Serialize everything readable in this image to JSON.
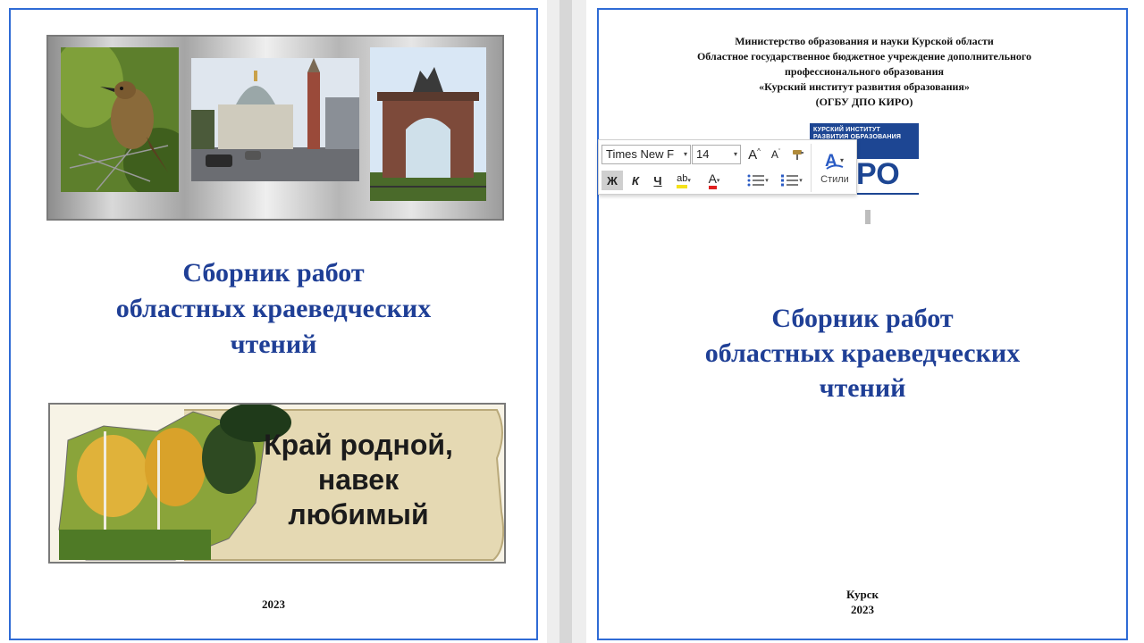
{
  "cover": {
    "title_lines": [
      "Сборник работ",
      "областных краеведческих",
      "чтений"
    ],
    "banner_lines": [
      "Край родной,",
      "навек",
      "любимый"
    ],
    "year": "2023"
  },
  "title_page": {
    "header_lines": [
      "Министерство образования и науки Курской области",
      "Областное государственное бюджетное учреждение дополнительного",
      "профессионального образования",
      "«Курский институт развития образования»",
      "(ОГБУ ДПО КИРО)"
    ],
    "logo_lines": [
      "КУРСКИЙ ИНСТИТУТ",
      "РАЗВИТИЯ ОБРАЗОВАНИЯ"
    ],
    "logo_letters": "РО",
    "title_lines": [
      "Сборник работ",
      "областных краеведческих",
      "чтений"
    ],
    "city": "Курск",
    "year": "2023"
  },
  "toolbar": {
    "font_name": "Times New F",
    "font_size": "14",
    "grow_font": "A",
    "shrink_font": "A",
    "bold": "Ж",
    "italic": "К",
    "underline": "Ч",
    "highlight": "ab",
    "font_color": "A",
    "styles_label": "Стили"
  },
  "colors": {
    "title_blue": "#1f3f96",
    "page_border": "#2f6bd5",
    "logo_blue": "#1d4693",
    "font_color_underline": "#e02020",
    "highlight_underline": "#f5e21a"
  },
  "icons": [
    "grow-font-icon",
    "shrink-font-icon",
    "format-painter-icon",
    "bullets-icon",
    "numbering-icon",
    "styles-icon"
  ]
}
